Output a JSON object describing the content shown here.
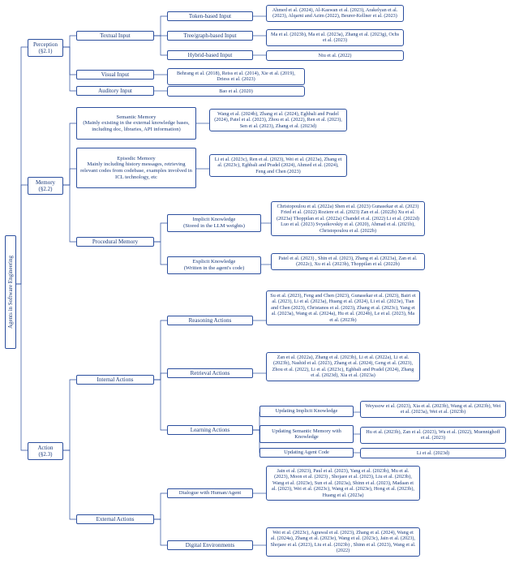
{
  "root": {
    "label": "Agents in Software Engineering"
  },
  "l1": {
    "perception": "Perception\n(§2.1)",
    "memory": "Memory\n(§2.2)",
    "action": "Action\n(§2.3)"
  },
  "perception": {
    "textual": "Textual Input",
    "visual": "Visual Input",
    "auditory": "Auditory Input",
    "token": "Token-based Input",
    "tree": "Tree/graph-based Input",
    "hybrid": "Hybrid-based Input",
    "refs_token": "Ahmed et al. (2024), Al-Kaswan et al. (2023), Arakelyan et al. (2023), Alqarni and Azim (2022), Beurer-Kellner et al. (2023)",
    "refs_tree": "Ma et al. (2023b), Ma et al. (2023a), Zhang et al. (2023g), Ochs et al. (2023)",
    "refs_hybrid": "Niu et al. (2022)",
    "refs_visual": "Behrang et al. (2018), Reiss et al. (2014), Xie et al. (2019), Driess et al. (2023)",
    "refs_auditory": "Bao et al. (2020)"
  },
  "memory": {
    "semantic": "Semantic Memory\n(Mainly existing in the external knowledge bases, including doc, libraries, API information)",
    "episodic": "Episodic Memory\nMainly including history messages, retrieving relevant codes from codebase, examples involved in ICL technology, etc",
    "procedural": "Procedural Memory",
    "implicit": "Implicit Knowledge\n(Stored in the LLM weights)",
    "explicit": "Explicit Knowledge\n(Written in the agent's code)",
    "refs_semantic": "Wang et al. (2024b), Zhang et al. (2024), Eghbali and Pradel (2024), Patel et al. (2023), Zhou et al. (2022), Ren et al. (2023), Sen et al. (2023), Zhang et al. (2023d)",
    "refs_episodic": "Li et al. (2023c), Ren et al. (2023), Wei et al. (2023a), Zhang et al. (2023c), Eghbali and Pradel (2024), Ahmed et al. (2024), Feng and Chen (2023)",
    "refs_implicit": "Christopoulou et al. (2022a) Shen et al. (2023) Gunasekar et al. (2023) Fried et al. (2022) Roziere et al. (2023) Zan et al. (2022b) Xu et al. (2023a) Thoppilan et al. (2022a) Chandel et al. (2022) Li et al. (2022d) Luo et al. (2023) Svyatkovskiy et al. (2020), Ahmad et al. (2021b), Christopoulou et al. (2022b)",
    "refs_explicit": "Patel et al. (2023) , Shin et al. (2023), Zhang et al. (2023a), Zan et al. (2022c), Xu et al. (2023b), Thoppilan et al. (2022b)"
  },
  "action": {
    "internal": "Internal Actions",
    "external": "External Actions",
    "reasoning": "Reasoning Actions",
    "retrieval": "Retrieval Actions",
    "learning": "Learning Actions",
    "dialogue": "Dialogue with Human/Agent",
    "digital": "Digital Environments",
    "upd_implicit": "Updating Implicit Knowledge",
    "upd_semantic": "Updating Semantic Memory with Knowledge",
    "upd_agent": "Updating Agent Code",
    "refs_reasoning": "Su et al. (2023), Feng and Chen (2023), Gunasekar et al. (2023), Bairi et al. (2023), Li et al. (2023a), Huang et al. (2024), Li et al. (2023e), Tian and Chen (2023), Christanos et al. (2023), Zhang et al. (2023c), Yang et al. (2023a), Wang et al. (2024a), Hu et al. (2024b), Le et al. (2023), Ma et al. (2023b)",
    "refs_retrieval": "Zan et al. (2022a), Zhang et al. (2023b), Li et al. (2022a), Li et al. (2023b), Nashid et al. (2023), Zhang et al. (2024), Geng et al. (2023), Zhou et al. (2022), Li et al. (2023c), Eghbali and Pradel (2024), Zhang et al. (2023d), Xia et al. (2023a)",
    "refs_upd_implicit": "Weyssow et al. (2023), Xia et al. (2023b), Wang et al. (2023b), Wei et al. (2023a), Wei et al. (2023b)",
    "refs_upd_semantic": "Hu et al. (2023b), Zan et al. (2023), Wu et al. (2022), Muennighoff et al. (2023)",
    "refs_upd_agent": "Li et al. (2023d)",
    "refs_dialogue": "Jain et al. (2023), Paul et al. (2023), Yang et al. (2023b), Mu et al. (2023), Moon et al. (2023) , Shojaee et al. (2023), Liu et al. (2023b), Wang et al. (2023e), Sun et al. (2023a), Shinn et al. (2023), Madaan et al. (2023), Wei et al. (2023c), Wang et al. (2023e), Hong et al. (2023b), Huang et al. (2023a)",
    "refs_digital": "Wei et al. (2023c), Agrawal et al. (2023), Zhang et al. (2024), Wang et al. (2024a), Zhang et al. (2023e), Wang et al. (2023c), Jain et al. (2023), Shojaee et al. (2023), Liu et al. (2023b) , Shinn et al. (2023), Wang et al. (2022)"
  }
}
